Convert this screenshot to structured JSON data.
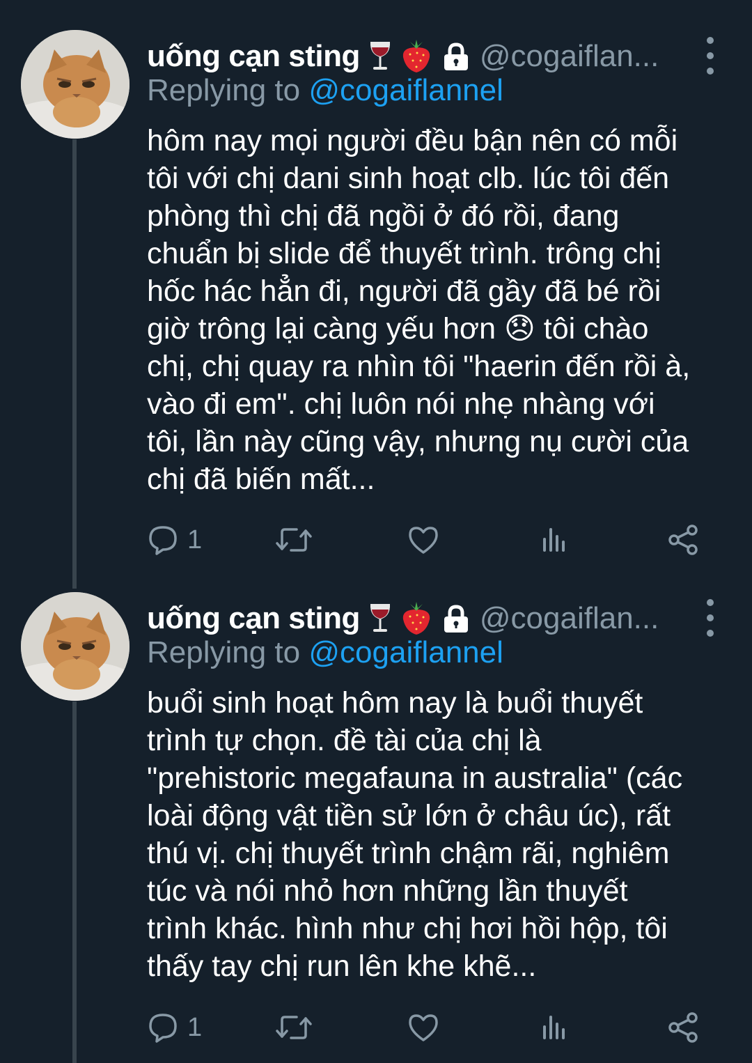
{
  "colors": {
    "background": "#15202b",
    "text": "#ffffff",
    "muted": "#8899a6",
    "link": "#1da1f2",
    "thread_line": "#38444d"
  },
  "tweets": [
    {
      "author": {
        "display_name": "uống cạn sting",
        "emojis": [
          "wine-glass-icon",
          "strawberry-icon",
          "lock-icon"
        ],
        "handle": "@cogaiflan...",
        "avatar": "cat-avatar"
      },
      "replying_prefix": "Replying to",
      "replying_handle": "@cogaiflannel",
      "text_lines": [
        "hôm nay mọi người đều bận nên có mỗi",
        "tôi với chị dani sinh hoạt clb. lúc tôi đến",
        "phòng thì chị đã ngồi ở đó rồi, đang",
        "chuẩn bị slide để thuyết trình. trông chị",
        "hốc hác hẳn đi, người đã gầy đã bé rồi",
        "giờ trông lại càng yếu hơn 😞 tôi chào",
        "chị, chị quay ra nhìn tôi \"haerin đến rồi à,",
        "vào đi em\". chị luôn nói nhẹ nhàng với",
        "tôi, lần này cũng vậy, nhưng nụ cười của",
        "chị đã biến mất..."
      ],
      "actions": {
        "reply_count": "1"
      }
    },
    {
      "author": {
        "display_name": "uống cạn sting",
        "emojis": [
          "wine-glass-icon",
          "strawberry-icon",
          "lock-icon"
        ],
        "handle": "@cogaiflan...",
        "avatar": "cat-avatar"
      },
      "replying_prefix": "Replying to",
      "replying_handle": "@cogaiflannel",
      "text_lines": [
        "buổi sinh hoạt hôm nay là buổi thuyết",
        "trình tự chọn. đề tài của chị là",
        "\"prehistoric megafauna in australia\" (các",
        "loài động vật tiền sử lớn ở châu úc), rất",
        "thú vị. chị thuyết trình chậm rãi, nghiêm",
        "túc và nói nhỏ hơn những lần thuyết",
        "trình khác. hình như chị hơi hồi hộp, tôi",
        "thấy tay chị run lên khe khẽ..."
      ],
      "actions": {
        "reply_count": "1"
      }
    }
  ]
}
